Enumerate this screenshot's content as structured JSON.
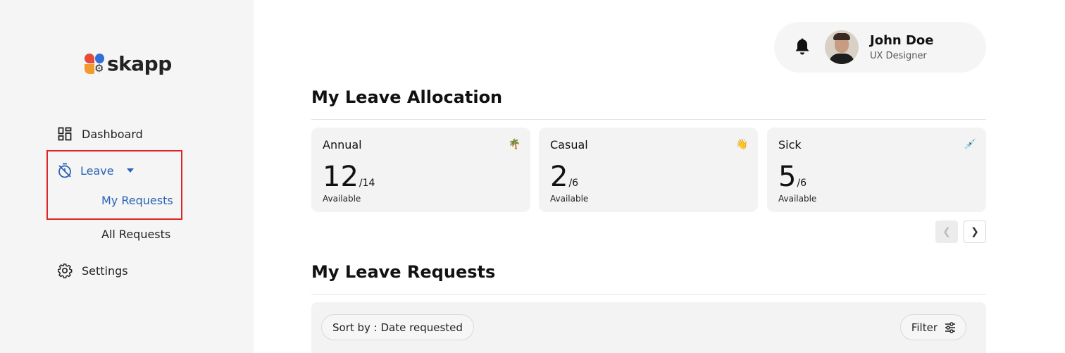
{
  "app": {
    "logo_text": "skapp"
  },
  "sidebar": {
    "items": [
      {
        "label": "Dashboard",
        "icon": "dashboard-icon"
      },
      {
        "label": "Leave",
        "icon": "timer-icon",
        "expanded": true,
        "children": [
          {
            "label": "My Requests",
            "active": true
          },
          {
            "label": "All Requests"
          }
        ]
      },
      {
        "label": "Settings",
        "icon": "gear-icon"
      }
    ]
  },
  "profile": {
    "name": "John Doe",
    "role": "UX Designer"
  },
  "allocation": {
    "title": "My Leave Allocation",
    "cards": [
      {
        "type": "Annual",
        "available": "12",
        "total": "/14",
        "label": "Available",
        "emoji": "🌴"
      },
      {
        "type": "Casual",
        "available": "2",
        "total": "/6",
        "label": "Available",
        "emoji": "👋"
      },
      {
        "type": "Sick",
        "available": "5",
        "total": "/6",
        "label": "Available",
        "emoji": "💉"
      }
    ]
  },
  "requests": {
    "title": "My Leave Requests",
    "sort_label": "Sort by : Date requested",
    "filter_label": "Filter"
  },
  "colors": {
    "accent": "#2a62b5",
    "highlight": "#e02424"
  }
}
